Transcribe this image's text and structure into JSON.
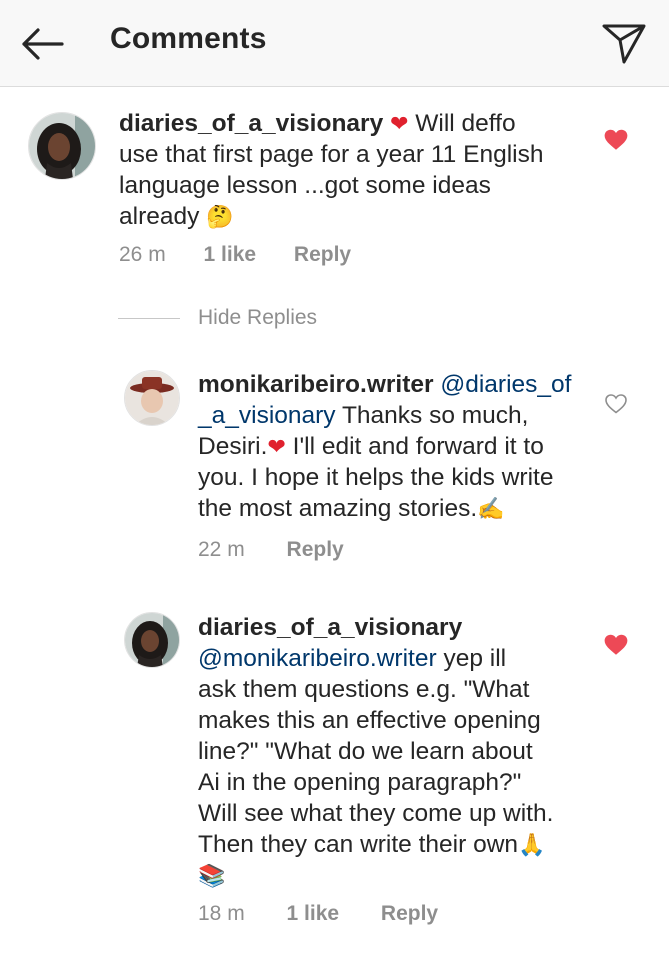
{
  "header": {
    "title": "Comments"
  },
  "comments": [
    {
      "username": "diaries_of_a_visionary",
      "lines": [
        "Will deffo",
        "use that first page for a year 11 English",
        "language lesson ...got some ideas",
        "already"
      ],
      "time": "26 m",
      "likes": "1 like",
      "reply": "Reply",
      "liked": true
    },
    {
      "username": "monikaribeiro.writer",
      "mention": "@diaries_of",
      "mention2": "_a_visionary",
      "lines": [
        "Thanks so much,",
        "Desiri.",
        "I'll edit and forward it to",
        "you. I hope it helps the kids write",
        "the most amazing stories."
      ],
      "time": "22 m",
      "reply": "Reply",
      "liked": false
    },
    {
      "username": "diaries_of_a_visionary",
      "mention": "@monikaribeiro.writer",
      "lines": [
        "yep ill",
        "ask them questions e.g. \"What",
        "makes this an effective opening",
        "line?\" \"What do we learn about",
        "Ai in the opening paragraph?\"",
        "Will see what they come up with.",
        "Then they can write their own"
      ],
      "time": "18 m",
      "likes": "1 like",
      "reply": "Reply",
      "liked": true
    }
  ],
  "replies_toggle": "Hide Replies",
  "colors": {
    "heart_liked": "#ed4956",
    "mention": "#00376b",
    "meta": "#8e8e8e"
  }
}
